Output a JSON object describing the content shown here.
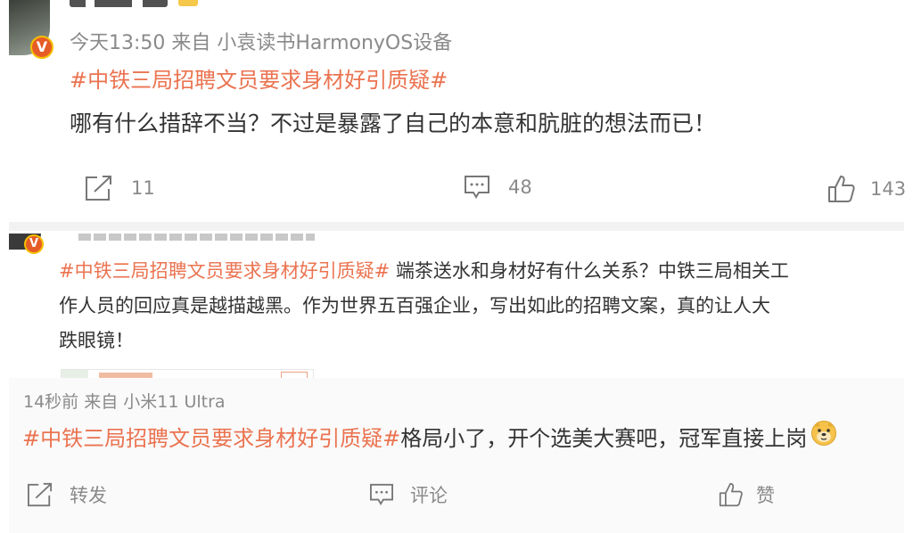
{
  "posts": [
    {
      "meta": "今天13:50  来自 小袁读书HarmonyOS设备",
      "topic": "#中铁三局招聘文员要求身材好引质疑#",
      "text": "哪有什么措辞不当？不过是暴露了自己的本意和肮脏的想法而已！",
      "repost_count": "11",
      "comment_count": "48",
      "like_count": "143",
      "verified_badge": "V"
    },
    {
      "topic": "#中铁三局招聘文员要求身材好引质疑#",
      "text_line1_rest": " 端茶送水和身材好有什么关系？中铁三局相关工",
      "text_line2": "作人员的回应真是越描越黑。作为世界五百强企业，写出如此的招聘文案，真的让人大",
      "text_line3": "跌眼镜！",
      "verified_badge": "V"
    },
    {
      "meta": "14秒前  来自 小米11 Ultra",
      "topic": "#中铁三局招聘文员要求身材好引质疑#",
      "text": "格局小了，开个选美大赛吧，冠军直接上岗",
      "emoji": "doge-emoji",
      "repost_label": "转发",
      "comment_label": "评论",
      "like_label": "赞"
    }
  ],
  "colors": {
    "topic": "#eb7350",
    "meta": "#8a8a8a",
    "badge": "#e65c26",
    "badge_ring": "#f5c000"
  }
}
